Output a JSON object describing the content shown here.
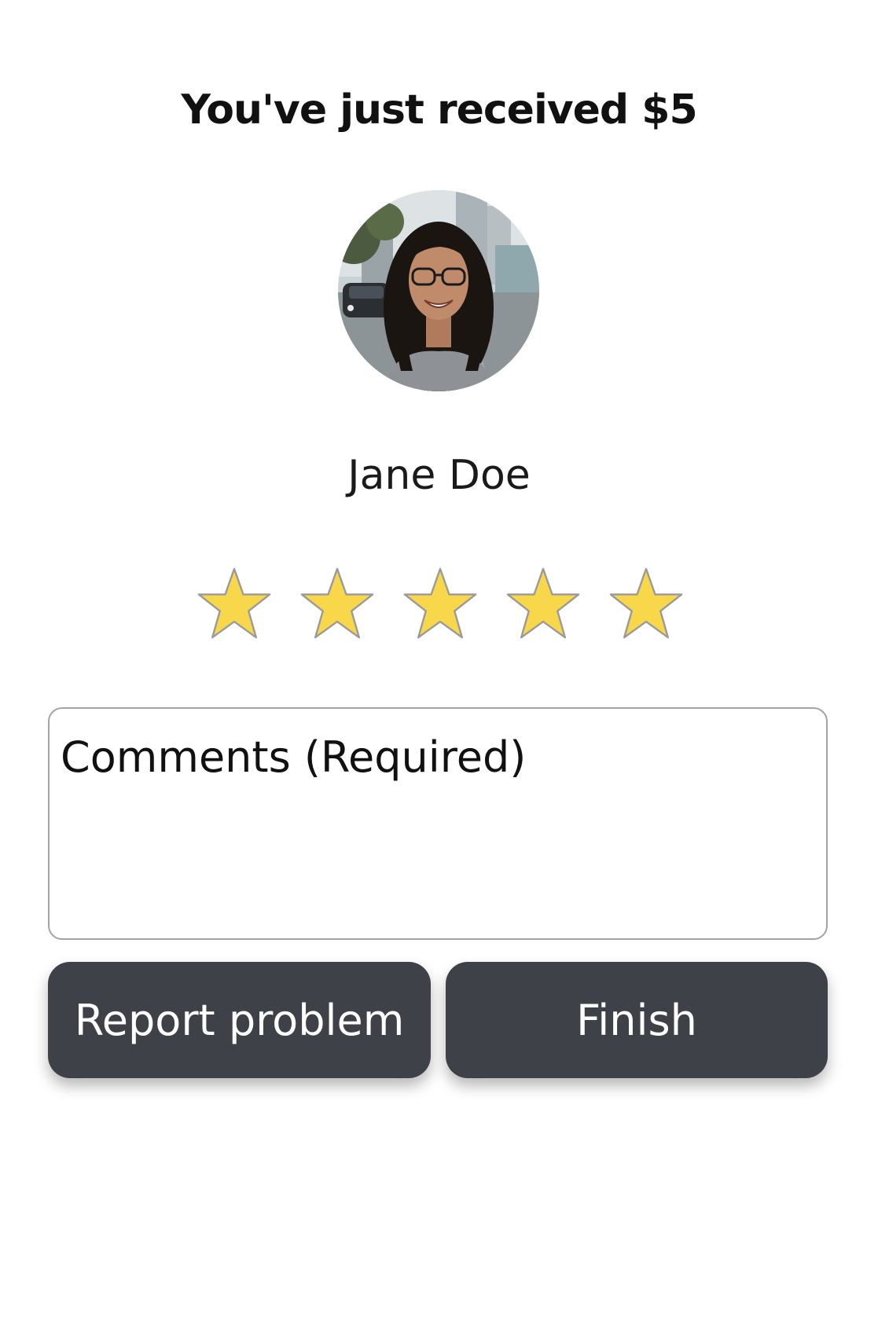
{
  "header": {
    "title": "You've just received $5"
  },
  "profile": {
    "name": "Jane Doe",
    "avatar": "person-photo"
  },
  "rating": {
    "value": 5,
    "max": 5,
    "star_fill_color": "#f8d84a",
    "star_stroke_color": "#9a9a9a",
    "icon": "star-icon"
  },
  "comments": {
    "placeholder": "Comments (Required)",
    "value": ""
  },
  "actions": {
    "report_label": "Report problem",
    "finish_label": "Finish",
    "button_color": "#3e4248"
  }
}
